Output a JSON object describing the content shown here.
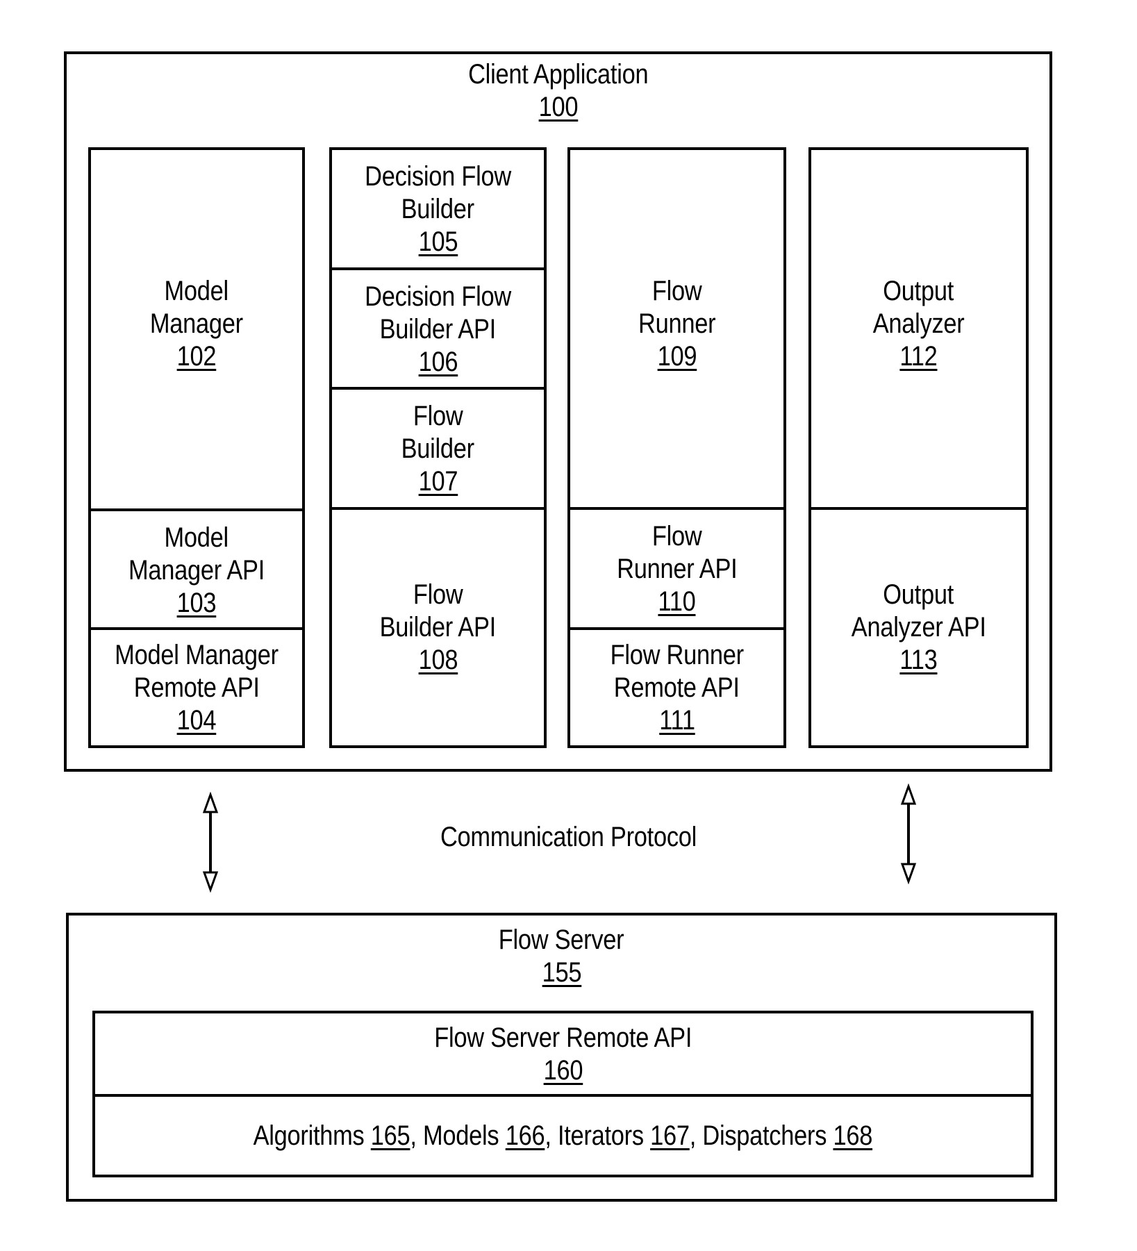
{
  "client_application": {
    "title": "Client Application",
    "number": "100",
    "columns": [
      {
        "cells": [
          {
            "lines": [
              "Model",
              "Manager"
            ],
            "number": "102"
          },
          {
            "lines": [
              "Model",
              "Manager API"
            ],
            "number": "103"
          },
          {
            "lines": [
              "Model Manager",
              "Remote API"
            ],
            "number": "104"
          }
        ]
      },
      {
        "cells": [
          {
            "lines": [
              "Decision Flow",
              "Builder"
            ],
            "number": "105"
          },
          {
            "lines": [
              "Decision Flow",
              "Builder API"
            ],
            "number": "106"
          },
          {
            "lines": [
              "Flow",
              "Builder"
            ],
            "number": "107"
          },
          {
            "lines": [
              "Flow",
              "Builder API"
            ],
            "number": "108"
          }
        ]
      },
      {
        "cells": [
          {
            "lines": [
              "Flow",
              "Runner"
            ],
            "number": "109"
          },
          {
            "lines": [
              "Flow",
              "Runner API"
            ],
            "number": "110"
          },
          {
            "lines": [
              "Flow Runner",
              "Remote API"
            ],
            "number": "111"
          }
        ]
      },
      {
        "cells": [
          {
            "lines": [
              "Output",
              "Analyzer"
            ],
            "number": "112"
          },
          {
            "lines": [
              "Output",
              "Analyzer API"
            ],
            "number": "113"
          }
        ]
      }
    ]
  },
  "communication": {
    "label": "Communication Protocol",
    "arrows": [
      "bidirectional-left",
      "bidirectional-right"
    ]
  },
  "flow_server": {
    "title": "Flow Server",
    "number": "155",
    "remote_api": {
      "label": "Flow Server Remote API",
      "number": "160"
    },
    "components": [
      {
        "label": "Algorithms",
        "number": "165",
        "sep": ", "
      },
      {
        "label": "Models",
        "number": "166",
        "sep": ", "
      },
      {
        "label": "Iterators",
        "number": "167",
        "sep": ", "
      },
      {
        "label": "Dispatchers",
        "number": "168",
        "sep": ""
      }
    ]
  }
}
